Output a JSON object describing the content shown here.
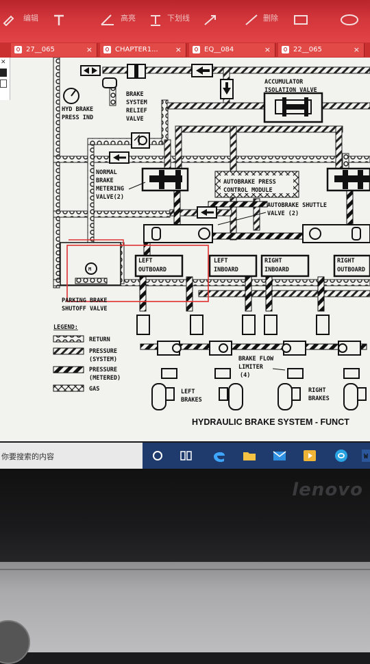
{
  "toolbar": {
    "items": [
      "编辑",
      "高亮",
      "下划线",
      "删除"
    ],
    "tools": [
      "pen-icon",
      "text-icon",
      "highlight-icon",
      "underline-icon",
      "arrow-icon",
      "line-icon",
      "rect-icon",
      "ellipse-icon"
    ]
  },
  "tabs": [
    {
      "label": "27__065"
    },
    {
      "label": "CHAPTER1..."
    },
    {
      "label": "EQ__084"
    },
    {
      "label": "22__065"
    }
  ],
  "diagram": {
    "hyd_brake": [
      "HYD BRAKE",
      "PRESS IND"
    ],
    "relief": [
      "BRAKE",
      "SYSTEM",
      "RELIEF",
      "VALVE"
    ],
    "accumulator": [
      "ACCUMULATOR",
      "ISOLATION VALVE"
    ],
    "metering": [
      "NORMAL",
      "BRAKE",
      "METERING",
      "VALVE(2)"
    ],
    "autobrake_module": [
      "AUTOBRAKE PRESS",
      "CONTROL MODULE"
    ],
    "shuttle": [
      "AUTOBRAKE SHUTTLE",
      "VALVE (2)"
    ],
    "left_outboard": [
      "LEFT",
      "OUTBOARD"
    ],
    "left_inboard": [
      "LEFT",
      "INBOARD"
    ],
    "right_inboard": [
      "RIGHT",
      "INBOARD"
    ],
    "right_outboard": [
      "RIGHT",
      "OUTBOARD"
    ],
    "parking": [
      "PARKING BRAKE",
      "SHUTOFF VALVE"
    ],
    "legend_title": "LEGEND:",
    "legend": [
      "RETURN",
      "PRESSURE",
      "(SYSTEM)",
      "PRESSURE",
      "(METERED)",
      "GAS"
    ],
    "flow_limiter": [
      "BRAKE FLOW",
      "LIMITER",
      "(4)"
    ],
    "left_brakes": [
      "LEFT",
      "BRAKES"
    ],
    "right_brakes": [
      "RIGHT",
      "BRAKES"
    ],
    "caption": "HYDRAULIC BRAKE SYSTEM - FUNCT",
    "gauge_letter": "M"
  },
  "taskbar": {
    "search_placeholder": "你要搜索的内容",
    "icons": [
      "cortana-icon",
      "task-view-icon",
      "edge-icon",
      "file-explorer-icon",
      "mail-icon",
      "media-player-icon",
      "app-icon",
      "word-icon"
    ]
  },
  "laptop": {
    "brand": "lenovo"
  },
  "colors": {
    "toolbar": "#d3363b",
    "tabbar": "#c9302f",
    "taskbar": "#1f3b6e",
    "highlight_box": "#e03030"
  }
}
